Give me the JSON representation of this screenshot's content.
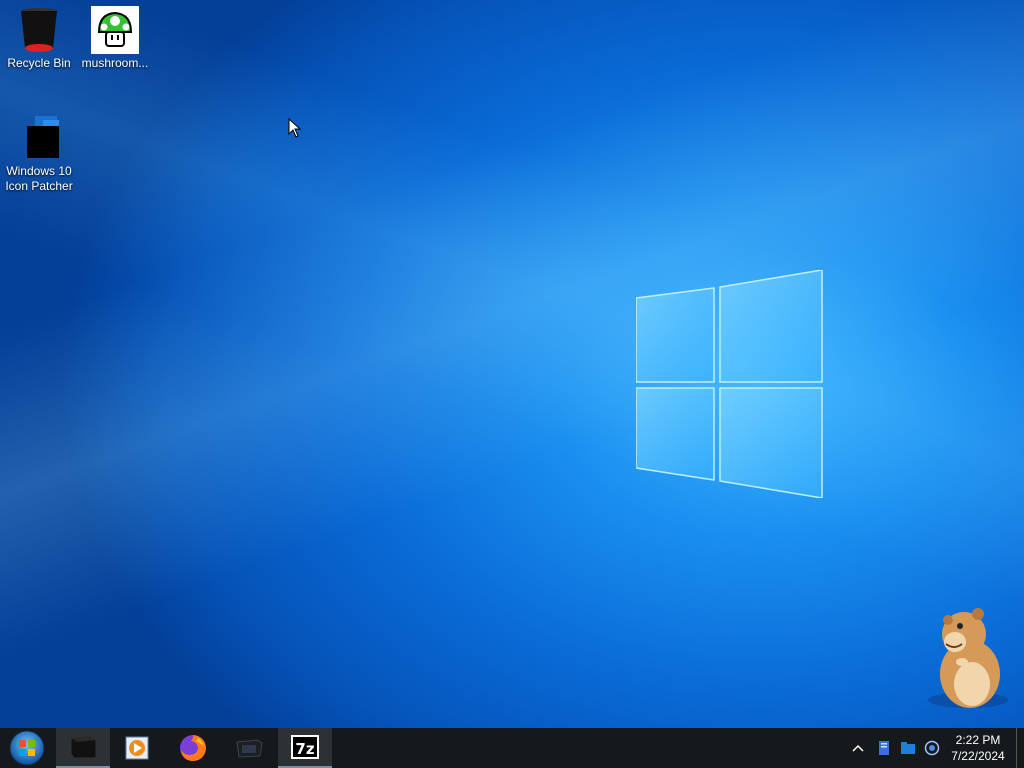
{
  "desktop": {
    "icons": [
      {
        "label": "Recycle Bin"
      },
      {
        "label": "mushroom..."
      },
      {
        "label_line1": "Windows 10",
        "label_line2": "Icon Patcher"
      }
    ]
  },
  "taskbar": {
    "apps": [
      "start-button",
      "black-app",
      "media-player",
      "firefox",
      "terminal",
      "7-zip"
    ],
    "seven_zip_label": "7z",
    "clock": {
      "time": "2:22 PM",
      "date": "7/22/2024"
    }
  },
  "colors": {
    "taskbar": "#16191c",
    "desktop_accent": "#1a8ff0"
  }
}
